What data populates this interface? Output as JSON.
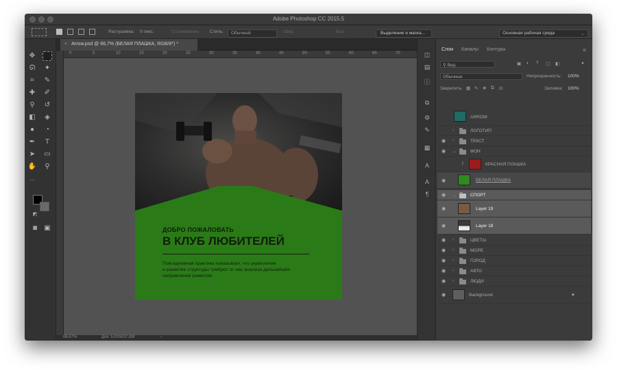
{
  "window": {
    "title": "Adobe Photoshop CC 2015.5"
  },
  "options_bar": {
    "feather_label": "Растушевка:",
    "feather_value": "0 пикс.",
    "antialias_label": "Сглаживание",
    "style_label": "Стиль:",
    "style_value": "Обычный",
    "width_label": "Шир:",
    "height_label": "Выс:",
    "select_mask_button": "Выделение и маска...",
    "workspace_value": "Основная рабочая среда"
  },
  "document": {
    "tab_title": "Arrow.psd @ 66,7% (БЕЛАЯ ПЛАШКА, RGB/8*) *",
    "ruler_ticks": [
      "0",
      "5",
      "10",
      "15",
      "20",
      "25",
      "30",
      "35",
      "40",
      "45",
      "50",
      "55",
      "60",
      "65",
      "70"
    ]
  },
  "artwork": {
    "heading_small": "ДОБРО ПОЖАЛОВАТЬ",
    "heading_large": "В КЛУБ ЛЮБИТЕЛЕЙ",
    "body_line1": "Повседневная практика показывает, что укрепление",
    "body_line2": "и развитие структуры требуют от нас анализа дальнейших",
    "body_line3": "направлений развития."
  },
  "status_bar": {
    "zoom": "66,67%",
    "doc_size": "Док: 5,81М/37,8М"
  },
  "layers_panel": {
    "tabs": [
      "Слои",
      "Каналы",
      "Контуры"
    ],
    "filter_kind": "Вид",
    "blend_mode": "Обычные",
    "opacity_label": "Непрозрачность:",
    "opacity_value": "100%",
    "lock_label": "Закрепить:",
    "fill_label": "Заливка:",
    "fill_value": "100%",
    "layers": [
      {
        "name": "ARROW",
        "type": "smart"
      },
      {
        "name": "ЛОГОТИП",
        "type": "folder"
      },
      {
        "name": "ТЕКСТ",
        "type": "folder"
      },
      {
        "name": "ФОН",
        "type": "folder"
      },
      {
        "name": "КРАСНАЯ ПЛАШКА",
        "type": "layer"
      },
      {
        "name": "БЕЛАЯ ПЛАШКА",
        "type": "layer"
      },
      {
        "name": "СПОРТ",
        "type": "folder"
      },
      {
        "name": "Layer 19",
        "type": "layer"
      },
      {
        "name": "Layer 18",
        "type": "layer"
      },
      {
        "name": "ЦВЕТЫ",
        "type": "folder"
      },
      {
        "name": "МОРЕ",
        "type": "folder"
      },
      {
        "name": "ГОРОД",
        "type": "folder"
      },
      {
        "name": "АВТО",
        "type": "folder"
      },
      {
        "name": "ЛЮДИ",
        "type": "folder"
      },
      {
        "name": "Background",
        "type": "background"
      }
    ]
  },
  "colors": {
    "artboard_green": "#2b7a18",
    "arrow_thumb": "#1f6b66",
    "red_plate": "#9a1c1c",
    "white_plate_green": "#2e8a1e",
    "layer19_brown": "#7a5a44"
  }
}
